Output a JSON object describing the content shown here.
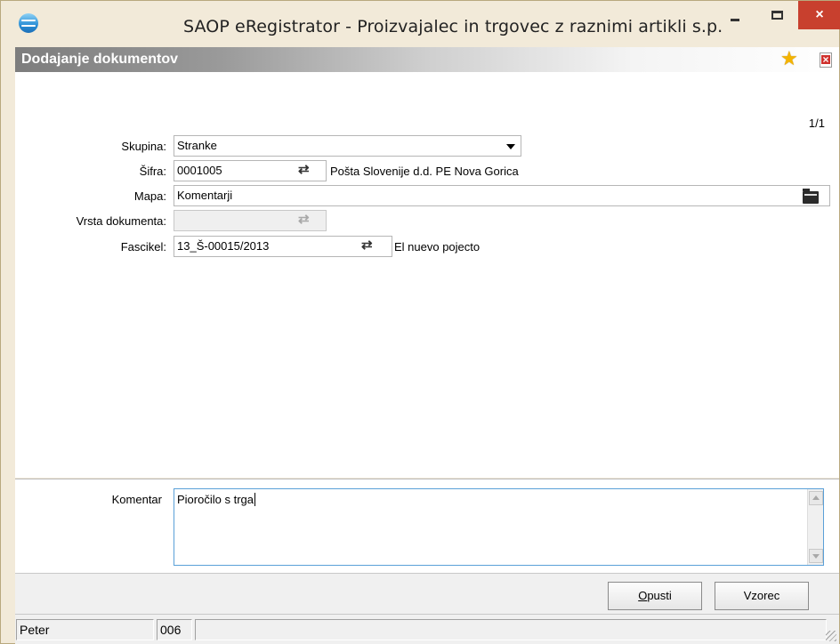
{
  "window": {
    "title": "SAOP eRegistrator - Proizvajalec in trgovec z raznimi artikli s.p.",
    "close_glyph": "×"
  },
  "header": {
    "title": "Dodajanje dokumentov",
    "favorite_icon": "star-icon",
    "close_doc_icon": "document-close-icon"
  },
  "form": {
    "page_indicator": "1/1",
    "skupina": {
      "label": "Skupina:",
      "value": "Stranke"
    },
    "sifra": {
      "label": "Šifra:",
      "value": "0001005",
      "description": "Pošta Slovenije d.d. PE Nova Gorica"
    },
    "mapa": {
      "label": "Mapa:",
      "value": "Komentarji"
    },
    "vrsta": {
      "label": "Vrsta dokumenta:",
      "value": ""
    },
    "fascikel": {
      "label": "Fascikel:",
      "value": "13_Š-00015/2013",
      "description": "El nuevo pojecto"
    }
  },
  "comment": {
    "label": "Komentar",
    "value": "Pioročilo s trga"
  },
  "buttons": {
    "opusti_first": "O",
    "opusti_rest": "pusti",
    "vzorec": "Vzorec"
  },
  "status": {
    "user": "Peter",
    "code": "006",
    "extra": ""
  },
  "icons": {
    "swap": "⇄"
  },
  "colors": {
    "close_button": "#c8402e",
    "frame": "#f2ead9",
    "focus_border": "#5aa0d8"
  }
}
